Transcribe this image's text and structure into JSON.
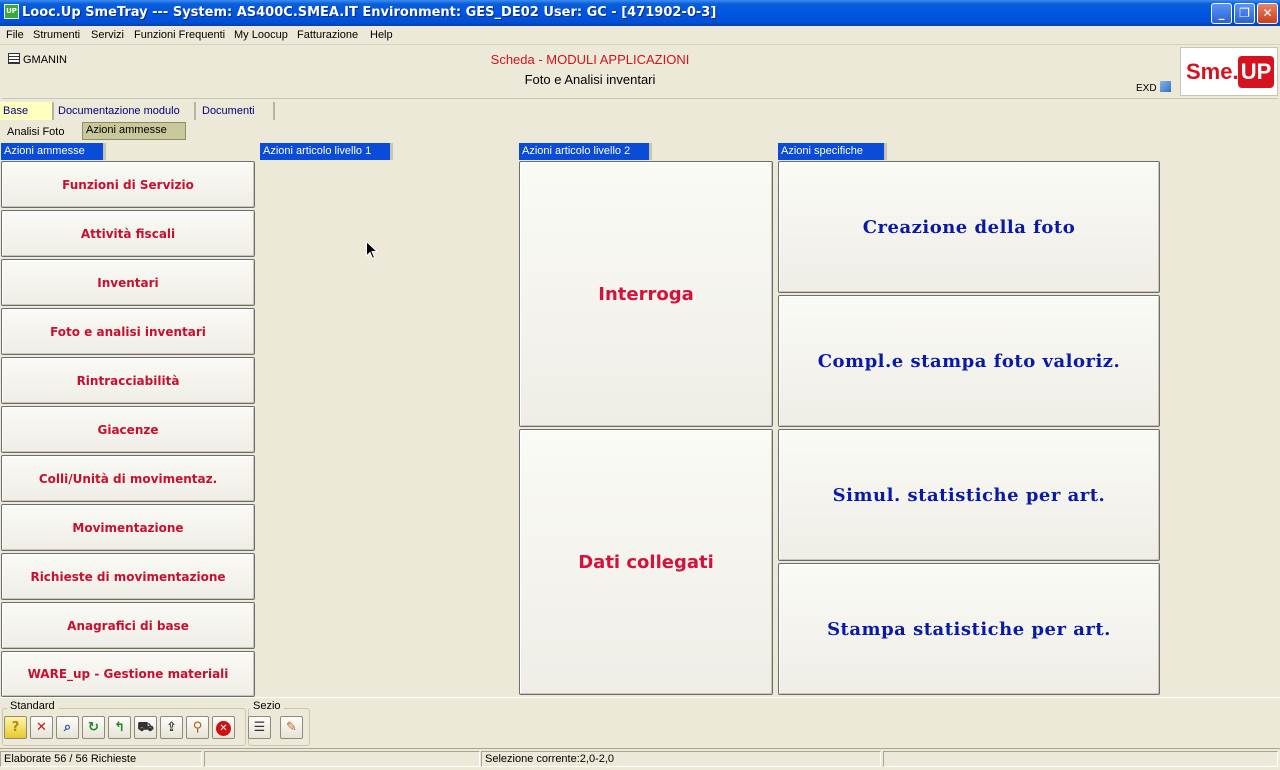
{
  "window": {
    "app_icon": "UP",
    "title": "Looc.Up SmeTray --- System: AS400C.SMEA.IT Environment: GES_DE02 User: GC - [471902-0-3]",
    "minimize": "_",
    "maximize": "❐",
    "close": "✕"
  },
  "menu": [
    "File",
    "Strumenti",
    "Servizi",
    "Funzioni Frequenti",
    "My Loocup",
    "Fatturazione",
    "Help"
  ],
  "header": {
    "module_code": "GMANIN",
    "title": "Scheda - MODULI APPLICAZIONI",
    "subtitle": "Foto e Analisi inventari",
    "exd_label": "EXD",
    "logo_text": "Sme.",
    "logo_badge": "UP"
  },
  "tabs_level1": [
    {
      "label": "Base",
      "selected": true
    },
    {
      "label": "Documentazione modulo",
      "selected": false
    },
    {
      "label": "Documenti",
      "selected": false
    }
  ],
  "tabs_level2": [
    {
      "label": "Analisi Foto",
      "selected": false
    },
    {
      "label": "Azioni ammesse",
      "selected": true
    }
  ],
  "panels": {
    "azioni_ammesse": {
      "header": "Azioni ammesse",
      "buttons": [
        "Funzioni di Servizio",
        "Attività fiscali",
        "Inventari",
        "Foto e analisi inventari",
        "Rintracciabilità",
        "Giacenze",
        "Colli/Unità di movimentaz.",
        "Movimentazione",
        "Richieste di movimentazione",
        "Anagrafici di base",
        "WARE_up - Gestione materiali"
      ]
    },
    "livello1": {
      "header": "Azioni articolo livello 1"
    },
    "livello2": {
      "header": "Azioni articolo livello 2",
      "buttons": [
        "Interroga",
        "Dati collegati"
      ]
    },
    "specifiche": {
      "header": "Azioni specifiche",
      "buttons": [
        "Creazione della foto",
        "Compl.e stampa foto valoriz.",
        "Simul. statistiche per art.",
        "Stampa statistiche per art."
      ]
    }
  },
  "toolbar": {
    "standard_label": "Standard",
    "sezio_label": "Sezio",
    "standard_icons": [
      "help-icon",
      "delete-icon",
      "search-icon",
      "refresh-icon",
      "back-icon",
      "cart-icon",
      "export-icon",
      "zoom-icon",
      "stop-icon"
    ],
    "sezio_icons": [
      "section-list-icon",
      "section-edit-icon"
    ]
  },
  "status": {
    "processed": "Elaborate 56 / 56 Richieste",
    "selection": "Selezione corrente:2,0-2,0"
  }
}
